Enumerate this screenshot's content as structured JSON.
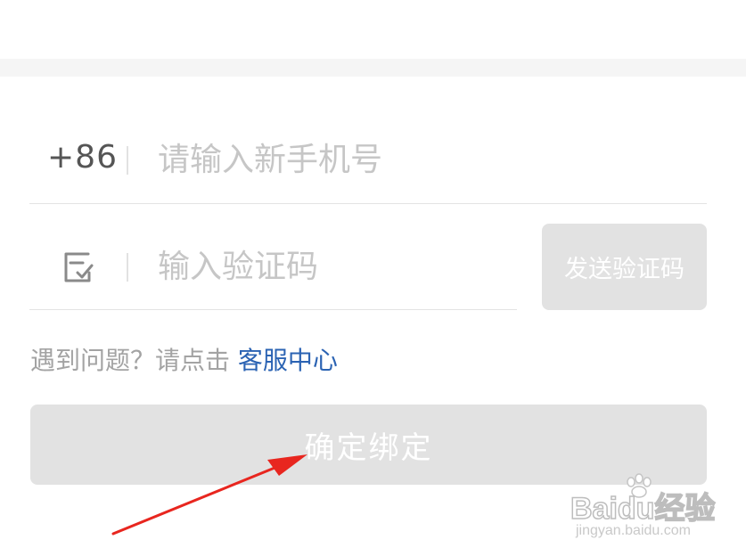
{
  "phone": {
    "country_code": "+86",
    "placeholder": "请输入新手机号",
    "value": ""
  },
  "verification": {
    "icon": "verify-code-icon",
    "placeholder": "输入验证码",
    "value": "",
    "send_button_label": "发送验证码"
  },
  "help": {
    "prefix": "遇到问题？请点击",
    "link_label": "客服中心"
  },
  "confirm_button_label": "确定绑定",
  "watermark": {
    "brand": "Baidu经验",
    "url": "jingyan.baidu.com"
  },
  "colors": {
    "link": "#2b63b3",
    "disabled_button": "#e2e2e2",
    "placeholder": "#c6c6c6",
    "annotation_arrow": "#e8261f"
  }
}
